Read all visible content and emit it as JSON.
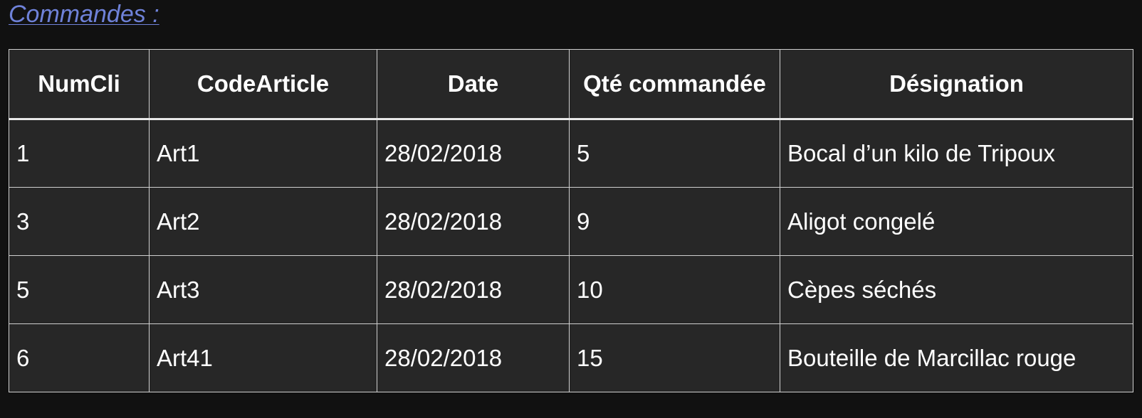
{
  "heading": "Commandes :",
  "table": {
    "headers": [
      "NumCli",
      "CodeArticle",
      "Date",
      "Qté commandée",
      "Désignation"
    ],
    "rows": [
      [
        "1",
        "Art1",
        "28/02/2018",
        "5",
        "Bocal d’un kilo  de Tripoux"
      ],
      [
        "3",
        "Art2",
        "28/02/2018",
        "9",
        "Aligot congelé"
      ],
      [
        "5",
        "Art3",
        "28/02/2018",
        "10",
        "Cèpes séchés"
      ],
      [
        "6",
        "Art41",
        "28/02/2018",
        "15",
        "Bouteille de Marcillac rouge"
      ]
    ]
  },
  "colors": {
    "background": "#111111",
    "table_background": "#272727",
    "heading": "#6f82d9",
    "border": "#cfcfcf",
    "text": "#ffffff"
  }
}
